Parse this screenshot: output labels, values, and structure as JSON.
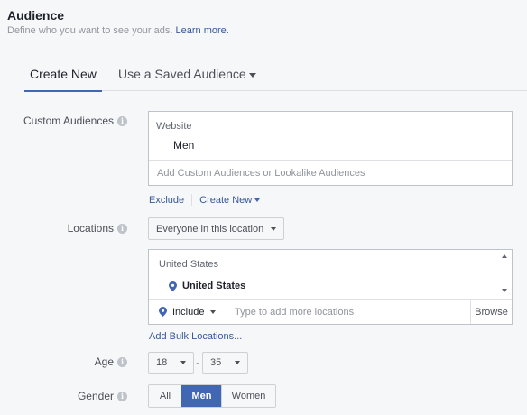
{
  "header": {
    "title": "Audience",
    "subtitle": "Define who you want to see your ads.",
    "learn_more": "Learn more."
  },
  "tabs": {
    "create_new": "Create New",
    "saved": "Use a Saved Audience"
  },
  "custom_audiences": {
    "label": "Custom Audiences",
    "section": "Website",
    "item": "Men",
    "placeholder": "Add Custom Audiences or Lookalike Audiences",
    "exclude": "Exclude",
    "create_new": "Create New"
  },
  "locations": {
    "label": "Locations",
    "mode": "Everyone in this location",
    "section": "United States",
    "item": "United States",
    "include": "Include",
    "placeholder": "Type to add more locations",
    "browse": "Browse",
    "bulk": "Add Bulk Locations..."
  },
  "age": {
    "label": "Age",
    "min": "18",
    "dash": "-",
    "max": "35"
  },
  "gender": {
    "label": "Gender",
    "options": [
      "All",
      "Men",
      "Women"
    ],
    "selected": "Men"
  },
  "colors": {
    "accent": "#4267b2",
    "link": "#365899"
  }
}
